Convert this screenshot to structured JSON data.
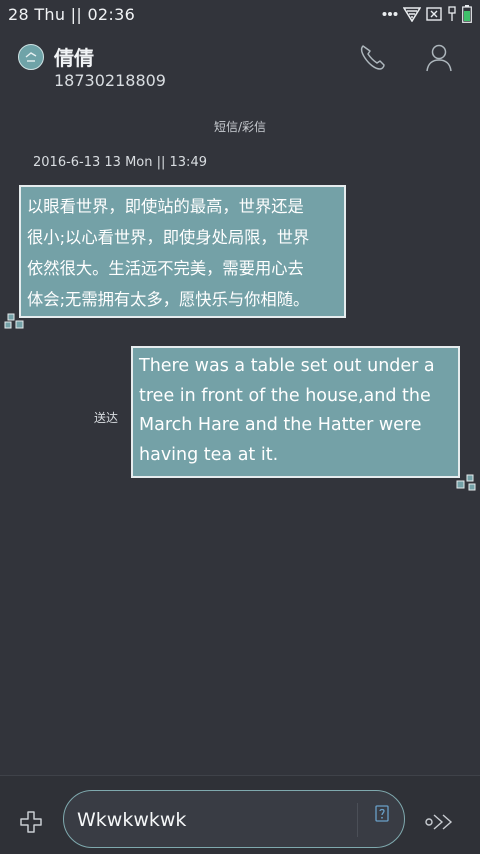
{
  "status_bar": {
    "time": "28  Thu  ||  02:36"
  },
  "header": {
    "contact_name": "倩倩",
    "contact_number": "18730218809"
  },
  "conversation": {
    "type_label": "短信/彩信",
    "date_stamp": "2016-6-13 13 Mon || 13:49",
    "messages": [
      {
        "direction": "incoming",
        "lines": [
          "以眼看世界，即使站的最高，世界还是",
          "很小;以心看世界，即使身处局限，世界",
          "依然很大。生活远不完美，需要用心去",
          "体会;无需拥有太多，愿快乐与你相随。"
        ]
      },
      {
        "direction": "outgoing",
        "status": "送达",
        "lines": [
          "There was a table set out under a",
          "tree in front of the house,and the",
          "March Hare and the Hatter were",
          "having tea at it."
        ]
      }
    ]
  },
  "composer": {
    "input_value": "Wkwkwkwk"
  },
  "colors": {
    "background": "#32343b",
    "bubble": "#74a1a7",
    "accent": "#7fa9ae"
  }
}
